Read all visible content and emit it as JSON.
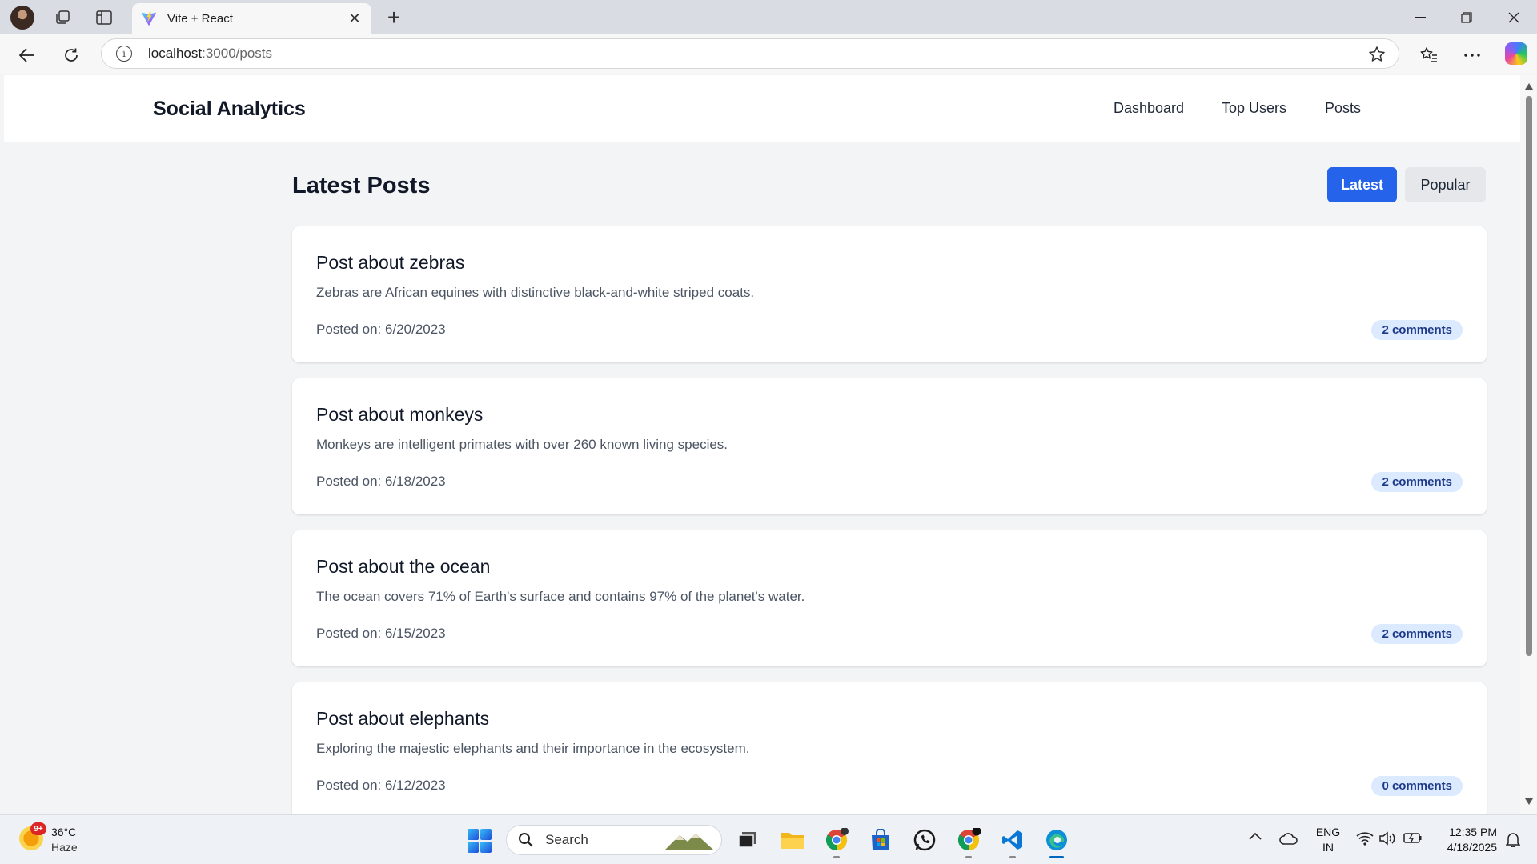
{
  "browser": {
    "tab_title": "Vite + React",
    "url_host": "localhost",
    "url_rest": ":3000/posts"
  },
  "site": {
    "brand": "Social Analytics",
    "nav": [
      "Dashboard",
      "Top Users",
      "Posts"
    ]
  },
  "page": {
    "title": "Latest Posts",
    "filter_latest": "Latest",
    "filter_popular": "Popular",
    "active_filter": "Latest"
  },
  "posts": [
    {
      "title": "Post about zebras",
      "body": "Zebras are African equines with distinctive black-and-white striped coats.",
      "date": "Posted on: 6/20/2023",
      "comments": "2 comments"
    },
    {
      "title": "Post about monkeys",
      "body": "Monkeys are intelligent primates with over 260 known living species.",
      "date": "Posted on: 6/18/2023",
      "comments": "2 comments"
    },
    {
      "title": "Post about the ocean",
      "body": "The ocean covers 71% of Earth's surface and contains 97% of the planet's water.",
      "date": "Posted on: 6/15/2023",
      "comments": "2 comments"
    },
    {
      "title": "Post about elephants",
      "body": "Exploring the majestic elephants and their importance in the ecosystem.",
      "date": "Posted on: 6/12/2023",
      "comments": "0 comments"
    }
  ],
  "taskbar": {
    "weather_badge": "9+",
    "weather_temp": "36°C",
    "weather_desc": "Haze",
    "search_label": "Search",
    "lang": "ENG",
    "region": "IN",
    "time": "12:35 PM",
    "date": "4/18/2025"
  },
  "colors": {
    "primary": "#2563eb",
    "badge_bg": "#dbeafe",
    "badge_text": "#1e3a8a",
    "page_bg": "#f3f4f6"
  }
}
